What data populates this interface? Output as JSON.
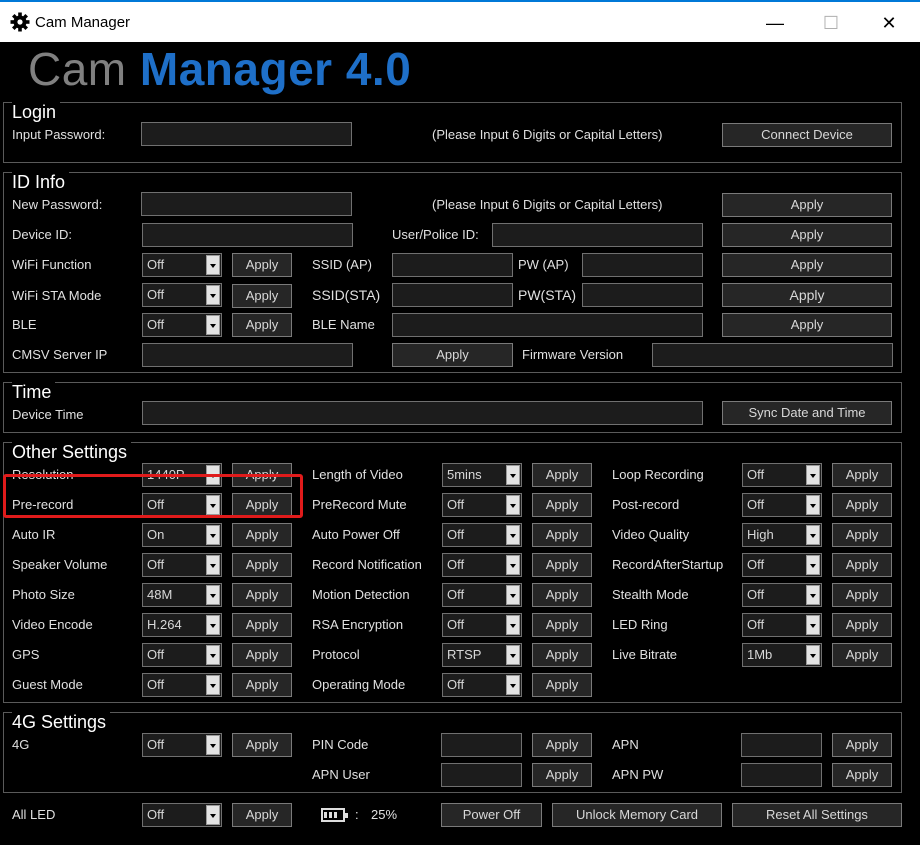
{
  "window": {
    "title": "Cam Manager",
    "minimize": "—",
    "maximize": "☐",
    "close": "✕"
  },
  "logo": {
    "part1": "Cam ",
    "part2": "Manager 4.0"
  },
  "login": {
    "title": "Login",
    "password_label": "Input Password:",
    "hint": "(Please Input 6 Digits or Capital Letters)",
    "connect": "Connect Device"
  },
  "idinfo": {
    "title": "ID Info",
    "new_password": "New Password:",
    "hint": "(Please Input 6 Digits or Capital Letters)",
    "device_id": "Device ID:",
    "user_id": "User/Police ID:",
    "wifi_function": "WiFi Function",
    "wifi_function_val": "Off",
    "ssid_ap": "SSID (AP)",
    "pw_ap": "PW (AP)",
    "wifi_sta": "WiFi STA Mode",
    "wifi_sta_val": "Off",
    "ssid_sta": "SSID(STA)",
    "pw_sta": "PW(STA)",
    "ble": "BLE",
    "ble_val": "Off",
    "ble_name": "BLE Name",
    "cmsv": "CMSV Server IP",
    "firmware": "Firmware Version"
  },
  "time": {
    "title": "Time",
    "device_time": "Device Time",
    "sync": "Sync Date and Time"
  },
  "other": {
    "title": "Other Settings",
    "col1": [
      {
        "label": "Resolution",
        "value": "1440P"
      },
      {
        "label": "Pre-record",
        "value": "Off"
      },
      {
        "label": "Auto IR",
        "value": "On"
      },
      {
        "label": "Speaker Volume",
        "value": "Off"
      },
      {
        "label": "Photo Size",
        "value": "48M"
      },
      {
        "label": "Video Encode",
        "value": "H.264"
      },
      {
        "label": "GPS",
        "value": "Off"
      },
      {
        "label": "Guest Mode",
        "value": "Off"
      }
    ],
    "col2": [
      {
        "label": "Length of Video",
        "value": "5mins"
      },
      {
        "label": "PreRecord Mute",
        "value": "Off"
      },
      {
        "label": "Auto Power Off",
        "value": "Off"
      },
      {
        "label": "Record Notification",
        "value": "Off"
      },
      {
        "label": "Motion Detection",
        "value": "Off"
      },
      {
        "label": "RSA Encryption",
        "value": "Off"
      },
      {
        "label": "Protocol",
        "value": "RTSP"
      },
      {
        "label": "Operating Mode",
        "value": "Off"
      }
    ],
    "col3": [
      {
        "label": "Loop Recording",
        "value": "Off"
      },
      {
        "label": "Post-record",
        "value": "Off"
      },
      {
        "label": "Video Quality",
        "value": "High"
      },
      {
        "label": "RecordAfterStartup",
        "value": "Off"
      },
      {
        "label": "Stealth Mode",
        "value": "Off"
      },
      {
        "label": "LED Ring",
        "value": "Off"
      },
      {
        "label": "Live Bitrate",
        "value": "1Mb"
      }
    ]
  },
  "g4": {
    "title": "4G Settings",
    "label": "4G",
    "value": "Off",
    "pin": "PIN Code",
    "apn_user": "APN User",
    "apn": "APN",
    "apn_pw": "APN PW"
  },
  "bottom": {
    "all_led": "All LED",
    "all_led_val": "Off",
    "battery_sep": ":",
    "battery": "25%",
    "power_off": "Power Off",
    "unlock": "Unlock Memory Card",
    "reset": "Reset All Settings"
  },
  "apply": "Apply",
  "colors": {
    "accent": "#1e6fc8",
    "highlight": "#e01b1b",
    "border": "#5a5a5a"
  }
}
